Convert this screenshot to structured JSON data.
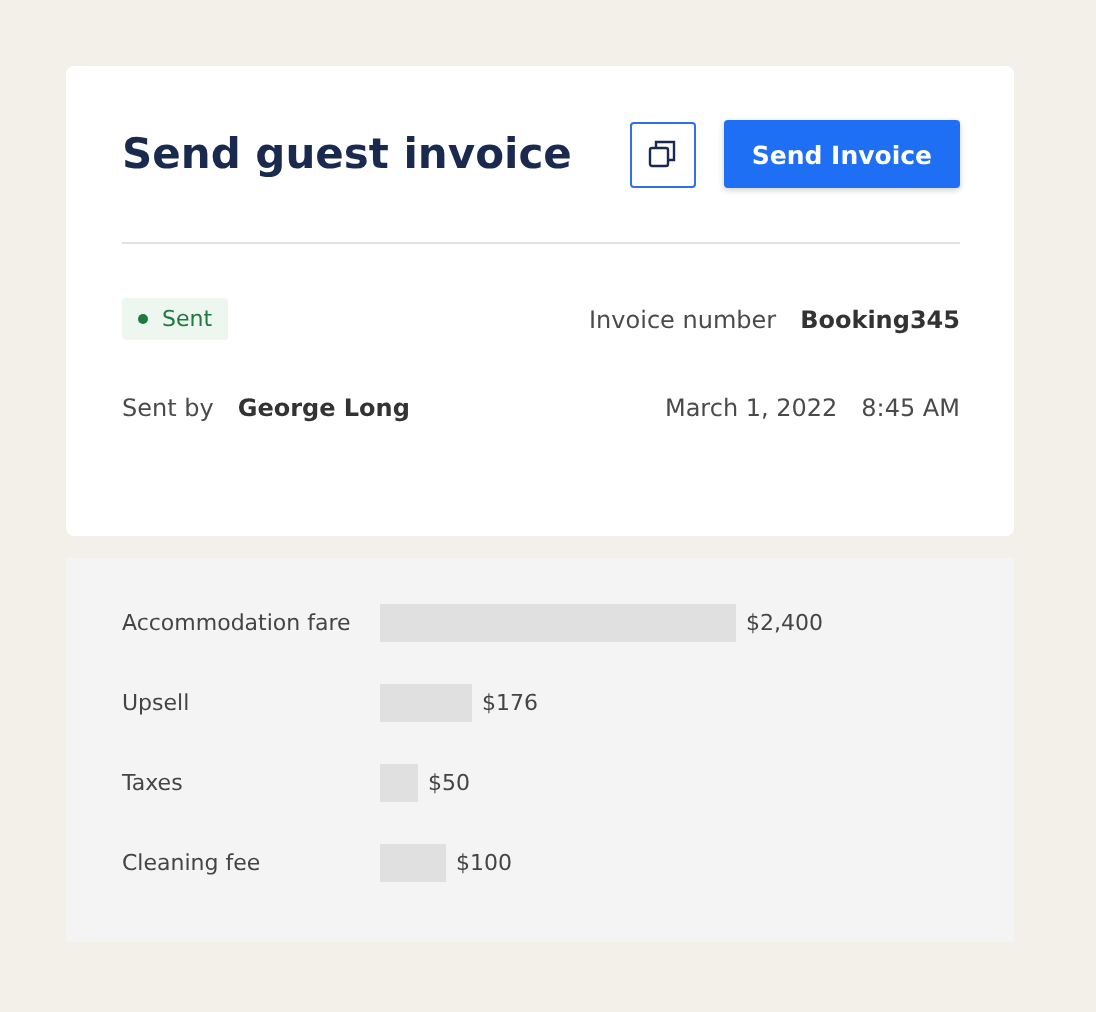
{
  "header": {
    "title": "Send guest invoice",
    "primary_button": "Send Invoice"
  },
  "status": {
    "label": "Sent",
    "color": "#1e7a3c"
  },
  "invoice_number": {
    "label": "Invoice number",
    "value": "Booking345"
  },
  "sent_by": {
    "label": "Sent by",
    "value": "George Long"
  },
  "sent_at": {
    "date": "March 1, 2022",
    "time": "8:45 AM"
  },
  "charges": [
    {
      "label": "Accommodation fare",
      "amount": "$2,400"
    },
    {
      "label": "Upsell",
      "amount": "$176"
    },
    {
      "label": "Taxes",
      "amount": "$50"
    },
    {
      "label": "Cleaning fee",
      "amount": "$100"
    }
  ]
}
